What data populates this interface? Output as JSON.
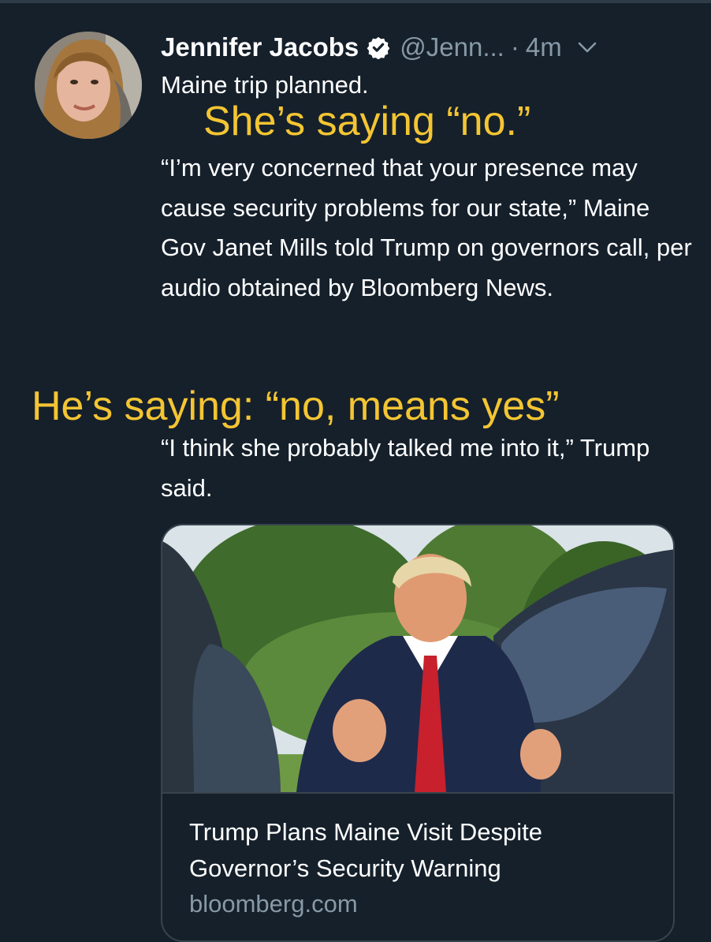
{
  "tweet": {
    "author_name": "Jennifer Jacobs",
    "handle": "@Jenn...",
    "separator": "·",
    "time_ago": "4m",
    "line1": "Maine trip planned.",
    "quote": "“I’m very concerned that your presence may cause security problems for our state,” Maine Gov Janet Mills told Trump on governors call, per audio obtained by Bloomberg News.",
    "trump_quote": "“I think she probably talked me into it,” Trump said."
  },
  "overlays": {
    "first": "She’s saying “no.”",
    "second": "He’s saying: “no, means yes”"
  },
  "card": {
    "title": "Trump Plans Maine Visit Despite Governor’s Security Warning",
    "domain": "bloomberg.com"
  },
  "icons": {
    "verified": "verified-badge-icon",
    "caret": "chevron-down-icon"
  },
  "colors": {
    "background": "#15202b",
    "secondary_text": "#8899a6",
    "overlay_text": "#f4c533",
    "border": "#38444d"
  }
}
